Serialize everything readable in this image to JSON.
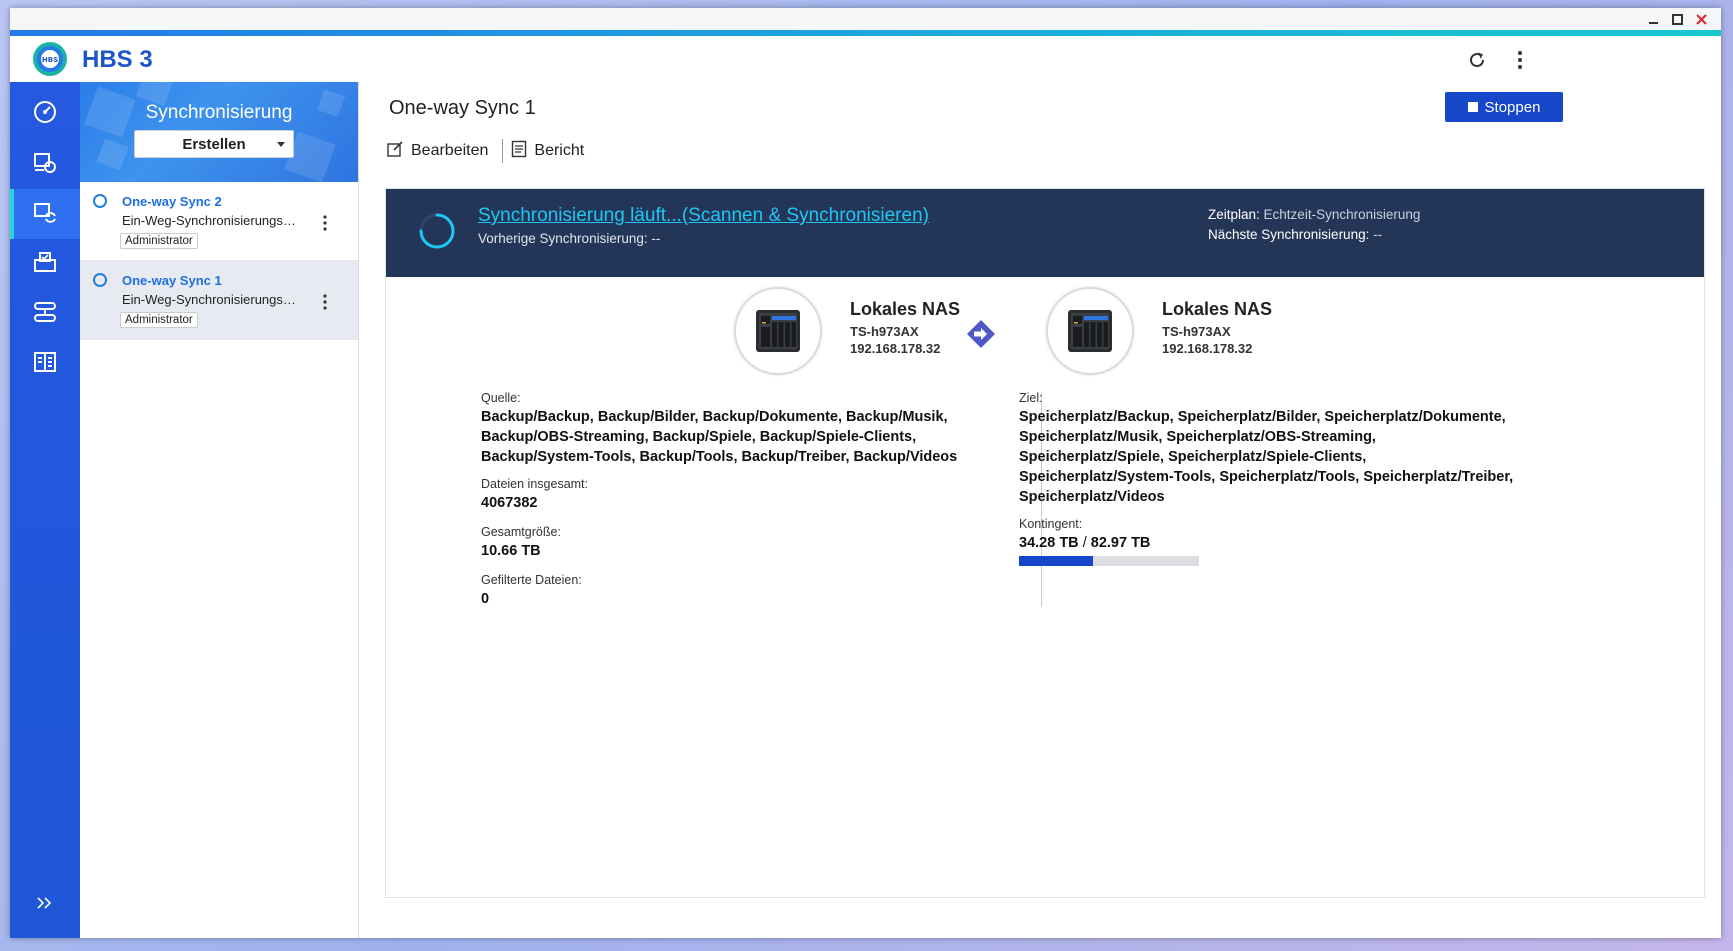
{
  "app": {
    "title": "HBS 3"
  },
  "panel": {
    "title": "Synchronisierung",
    "create_label": "Erstellen"
  },
  "jobs": [
    {
      "name": "One-way Sync 2",
      "type": "Ein-Weg-Synchronisierungsauftrag",
      "owner": "Administrator",
      "selected": false
    },
    {
      "name": "One-way Sync 1",
      "type": "Ein-Weg-Synchronisierungsauftrag",
      "owner": "Administrator",
      "selected": true
    }
  ],
  "main": {
    "title": "One-way Sync 1",
    "stop_label": "Stoppen",
    "toolbar": {
      "edit_label": "Bearbeiten",
      "report_label": "Bericht"
    }
  },
  "status": {
    "text": "Synchronisierung läuft...(Scannen & Synchronisieren)",
    "previous_label": "Vorherige Synchronisierung:",
    "previous_value": "--",
    "schedule_label": "Zeitplan:",
    "schedule_value": "Echtzeit-Synchronisierung",
    "next_label": "Nächste Synchronisierung:",
    "next_value": "--"
  },
  "source_device": {
    "name": "Lokales NAS",
    "model": "TS-h973AX",
    "ip": "192.168.178.32"
  },
  "target_device": {
    "name": "Lokales NAS",
    "model": "TS-h973AX",
    "ip": "192.168.178.32"
  },
  "source": {
    "label": "Quelle:",
    "lines": [
      "Backup/Backup, Backup/Bilder, Backup/Dokumente, Backup/Musik,",
      "Backup/OBS-Streaming, Backup/Spiele, Backup/Spiele-Clients,",
      "Backup/System-Tools, Backup/Tools, Backup/Treiber, Backup/Videos"
    ],
    "total_files_label": "Dateien insgesamt:",
    "total_files_value": "4067382",
    "total_size_label": "Gesamtgröße:",
    "total_size_value": "10.66 TB",
    "filtered_label": "Gefilterte Dateien:",
    "filtered_value": "0"
  },
  "target": {
    "label": "Ziel:",
    "lines": [
      "Speicherplatz/Backup, Speicherplatz/Bilder, Speicherplatz/Dokumente,",
      "Speicherplatz/Musik, Speicherplatz/OBS-Streaming,",
      "Speicherplatz/Spiele, Speicherplatz/Spiele-Clients,",
      "Speicherplatz/System-Tools, Speicherplatz/Tools, Speicherplatz/Treiber,",
      "Speicherplatz/Videos"
    ],
    "quota_label": "Kontingent:",
    "quota_used": "34.28 TB",
    "quota_sep": "/",
    "quota_total": "82.97 TB",
    "quota_fraction": 0.413
  },
  "colors": {
    "accent": "#1747c9",
    "nav": "#1f57d7",
    "status_bg": "#243658",
    "status_link": "#1fc6f5"
  },
  "nav_icons": [
    "dashboard-icon",
    "backup-restore-icon",
    "sync-icon",
    "job-list-icon",
    "storage-space-icon",
    "logs-icon"
  ]
}
